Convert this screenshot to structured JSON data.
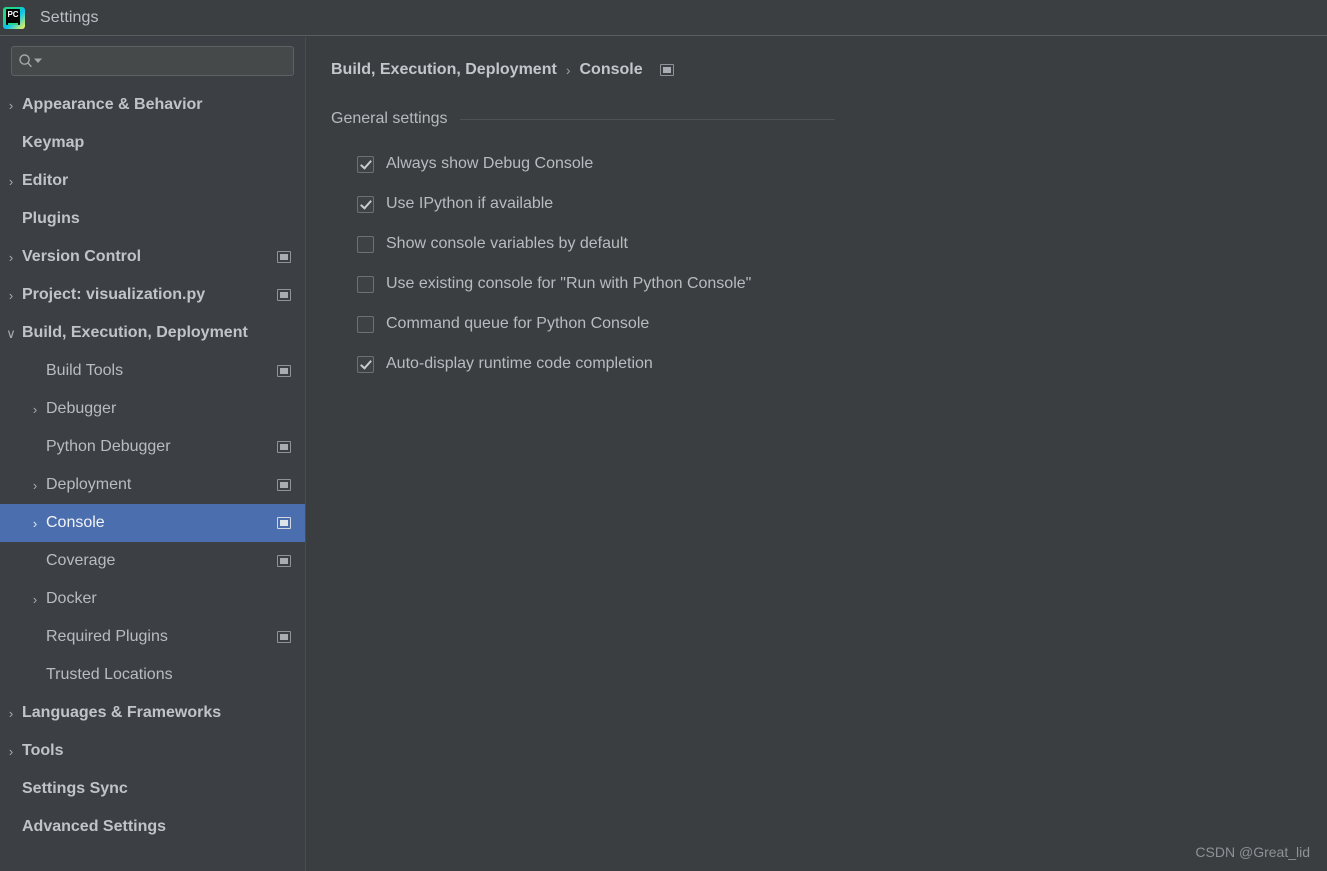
{
  "window": {
    "title": "Settings",
    "logo_icon": "pycharm-logo-icon",
    "logo_text": "PC"
  },
  "search": {
    "value": "",
    "placeholder": "",
    "icon": "search-icon",
    "dropdown_icon": "chevron-down-icon"
  },
  "sidebar": {
    "items": [
      {
        "label": "Appearance & Behavior",
        "level": 0,
        "twisty": "›",
        "bold": true,
        "scope": false,
        "selected": false
      },
      {
        "label": "Keymap",
        "level": 0,
        "twisty": "",
        "bold": true,
        "scope": false,
        "selected": false
      },
      {
        "label": "Editor",
        "level": 0,
        "twisty": "›",
        "bold": true,
        "scope": false,
        "selected": false
      },
      {
        "label": "Plugins",
        "level": 0,
        "twisty": "",
        "bold": true,
        "scope": false,
        "selected": false
      },
      {
        "label": "Version Control",
        "level": 0,
        "twisty": "›",
        "bold": true,
        "scope": true,
        "selected": false
      },
      {
        "label": "Project: visualization.py",
        "level": 0,
        "twisty": "›",
        "bold": true,
        "scope": true,
        "selected": false
      },
      {
        "label": "Build, Execution, Deployment",
        "level": 0,
        "twisty": "∨",
        "bold": true,
        "scope": false,
        "selected": false
      },
      {
        "label": "Build Tools",
        "level": 1,
        "twisty": "",
        "bold": false,
        "scope": true,
        "selected": false
      },
      {
        "label": "Debugger",
        "level": 1,
        "twisty": "›",
        "bold": false,
        "scope": false,
        "selected": false
      },
      {
        "label": "Python Debugger",
        "level": 1,
        "twisty": "",
        "bold": false,
        "scope": true,
        "selected": false
      },
      {
        "label": "Deployment",
        "level": 1,
        "twisty": "›",
        "bold": false,
        "scope": true,
        "selected": false
      },
      {
        "label": "Console",
        "level": 1,
        "twisty": "›",
        "bold": false,
        "scope": true,
        "selected": true
      },
      {
        "label": "Coverage",
        "level": 1,
        "twisty": "",
        "bold": false,
        "scope": true,
        "selected": false
      },
      {
        "label": "Docker",
        "level": 1,
        "twisty": "›",
        "bold": false,
        "scope": false,
        "selected": false
      },
      {
        "label": "Required Plugins",
        "level": 1,
        "twisty": "",
        "bold": false,
        "scope": true,
        "selected": false
      },
      {
        "label": "Trusted Locations",
        "level": 1,
        "twisty": "",
        "bold": false,
        "scope": false,
        "selected": false
      },
      {
        "label": "Languages & Frameworks",
        "level": 0,
        "twisty": "›",
        "bold": true,
        "scope": false,
        "selected": false
      },
      {
        "label": "Tools",
        "level": 0,
        "twisty": "›",
        "bold": true,
        "scope": false,
        "selected": false
      },
      {
        "label": "Settings Sync",
        "level": 0,
        "twisty": "",
        "bold": true,
        "scope": false,
        "selected": false
      },
      {
        "label": "Advanced Settings",
        "level": 0,
        "twisty": "",
        "bold": true,
        "scope": false,
        "selected": false
      }
    ]
  },
  "main": {
    "breadcrumb": {
      "parent": "Build, Execution, Deployment",
      "separator": "›",
      "current": "Console",
      "scope_icon": "project-scope-icon"
    },
    "section": {
      "title": "General settings"
    },
    "options": [
      {
        "label": "Always show Debug Console",
        "checked": true
      },
      {
        "label": "Use IPython if available",
        "checked": true
      },
      {
        "label": "Show console variables by default",
        "checked": false
      },
      {
        "label": "Use existing console for \"Run with Python Console\"",
        "checked": false
      },
      {
        "label": "Command queue for Python Console",
        "checked": false
      },
      {
        "label": "Auto-display runtime code completion",
        "checked": true
      }
    ]
  },
  "watermark": {
    "text": "CSDN @Great_lid"
  },
  "colors": {
    "titlebar_bg": "#3c3f41",
    "sidebar_bg": "#3c4044",
    "main_bg": "#3b3e40",
    "selection_blue": "#4b6eaf",
    "text": "#b8bcc0"
  }
}
